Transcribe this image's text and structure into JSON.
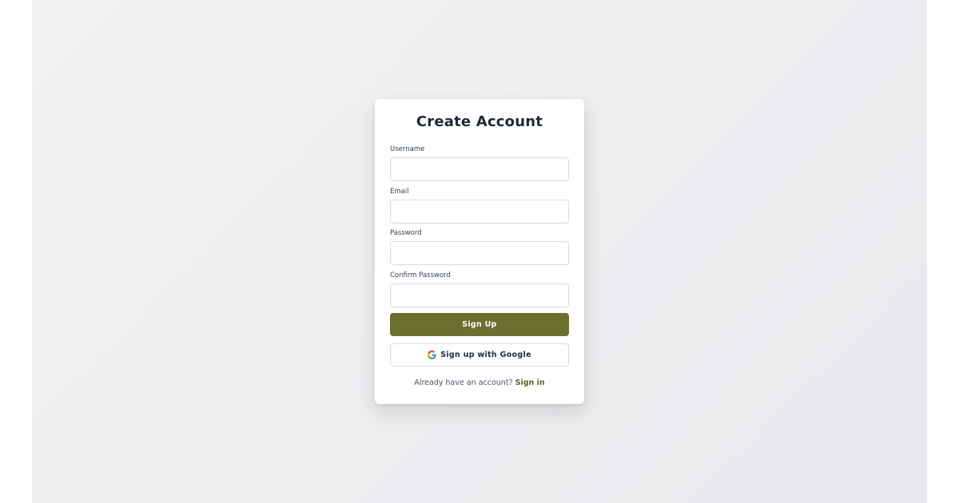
{
  "form": {
    "title": "Create Account",
    "fields": {
      "username": {
        "label": "Username",
        "value": "",
        "placeholder": ""
      },
      "email": {
        "label": "Email",
        "value": "",
        "placeholder": ""
      },
      "password": {
        "label": "Password",
        "value": "",
        "placeholder": ""
      },
      "confirm_password": {
        "label": "Confirm Password",
        "value": "",
        "placeholder": ""
      }
    },
    "submit_label": "Sign Up",
    "google_label": "Sign up with Google",
    "google_icon": "google-g-icon",
    "footer_text": "Already have an account?",
    "signin_link": "Sign in"
  },
  "colors": {
    "primary": "#6b6f2e",
    "link": "#5d6327",
    "title": "#1f2a37",
    "border": "#d9dbe0"
  }
}
